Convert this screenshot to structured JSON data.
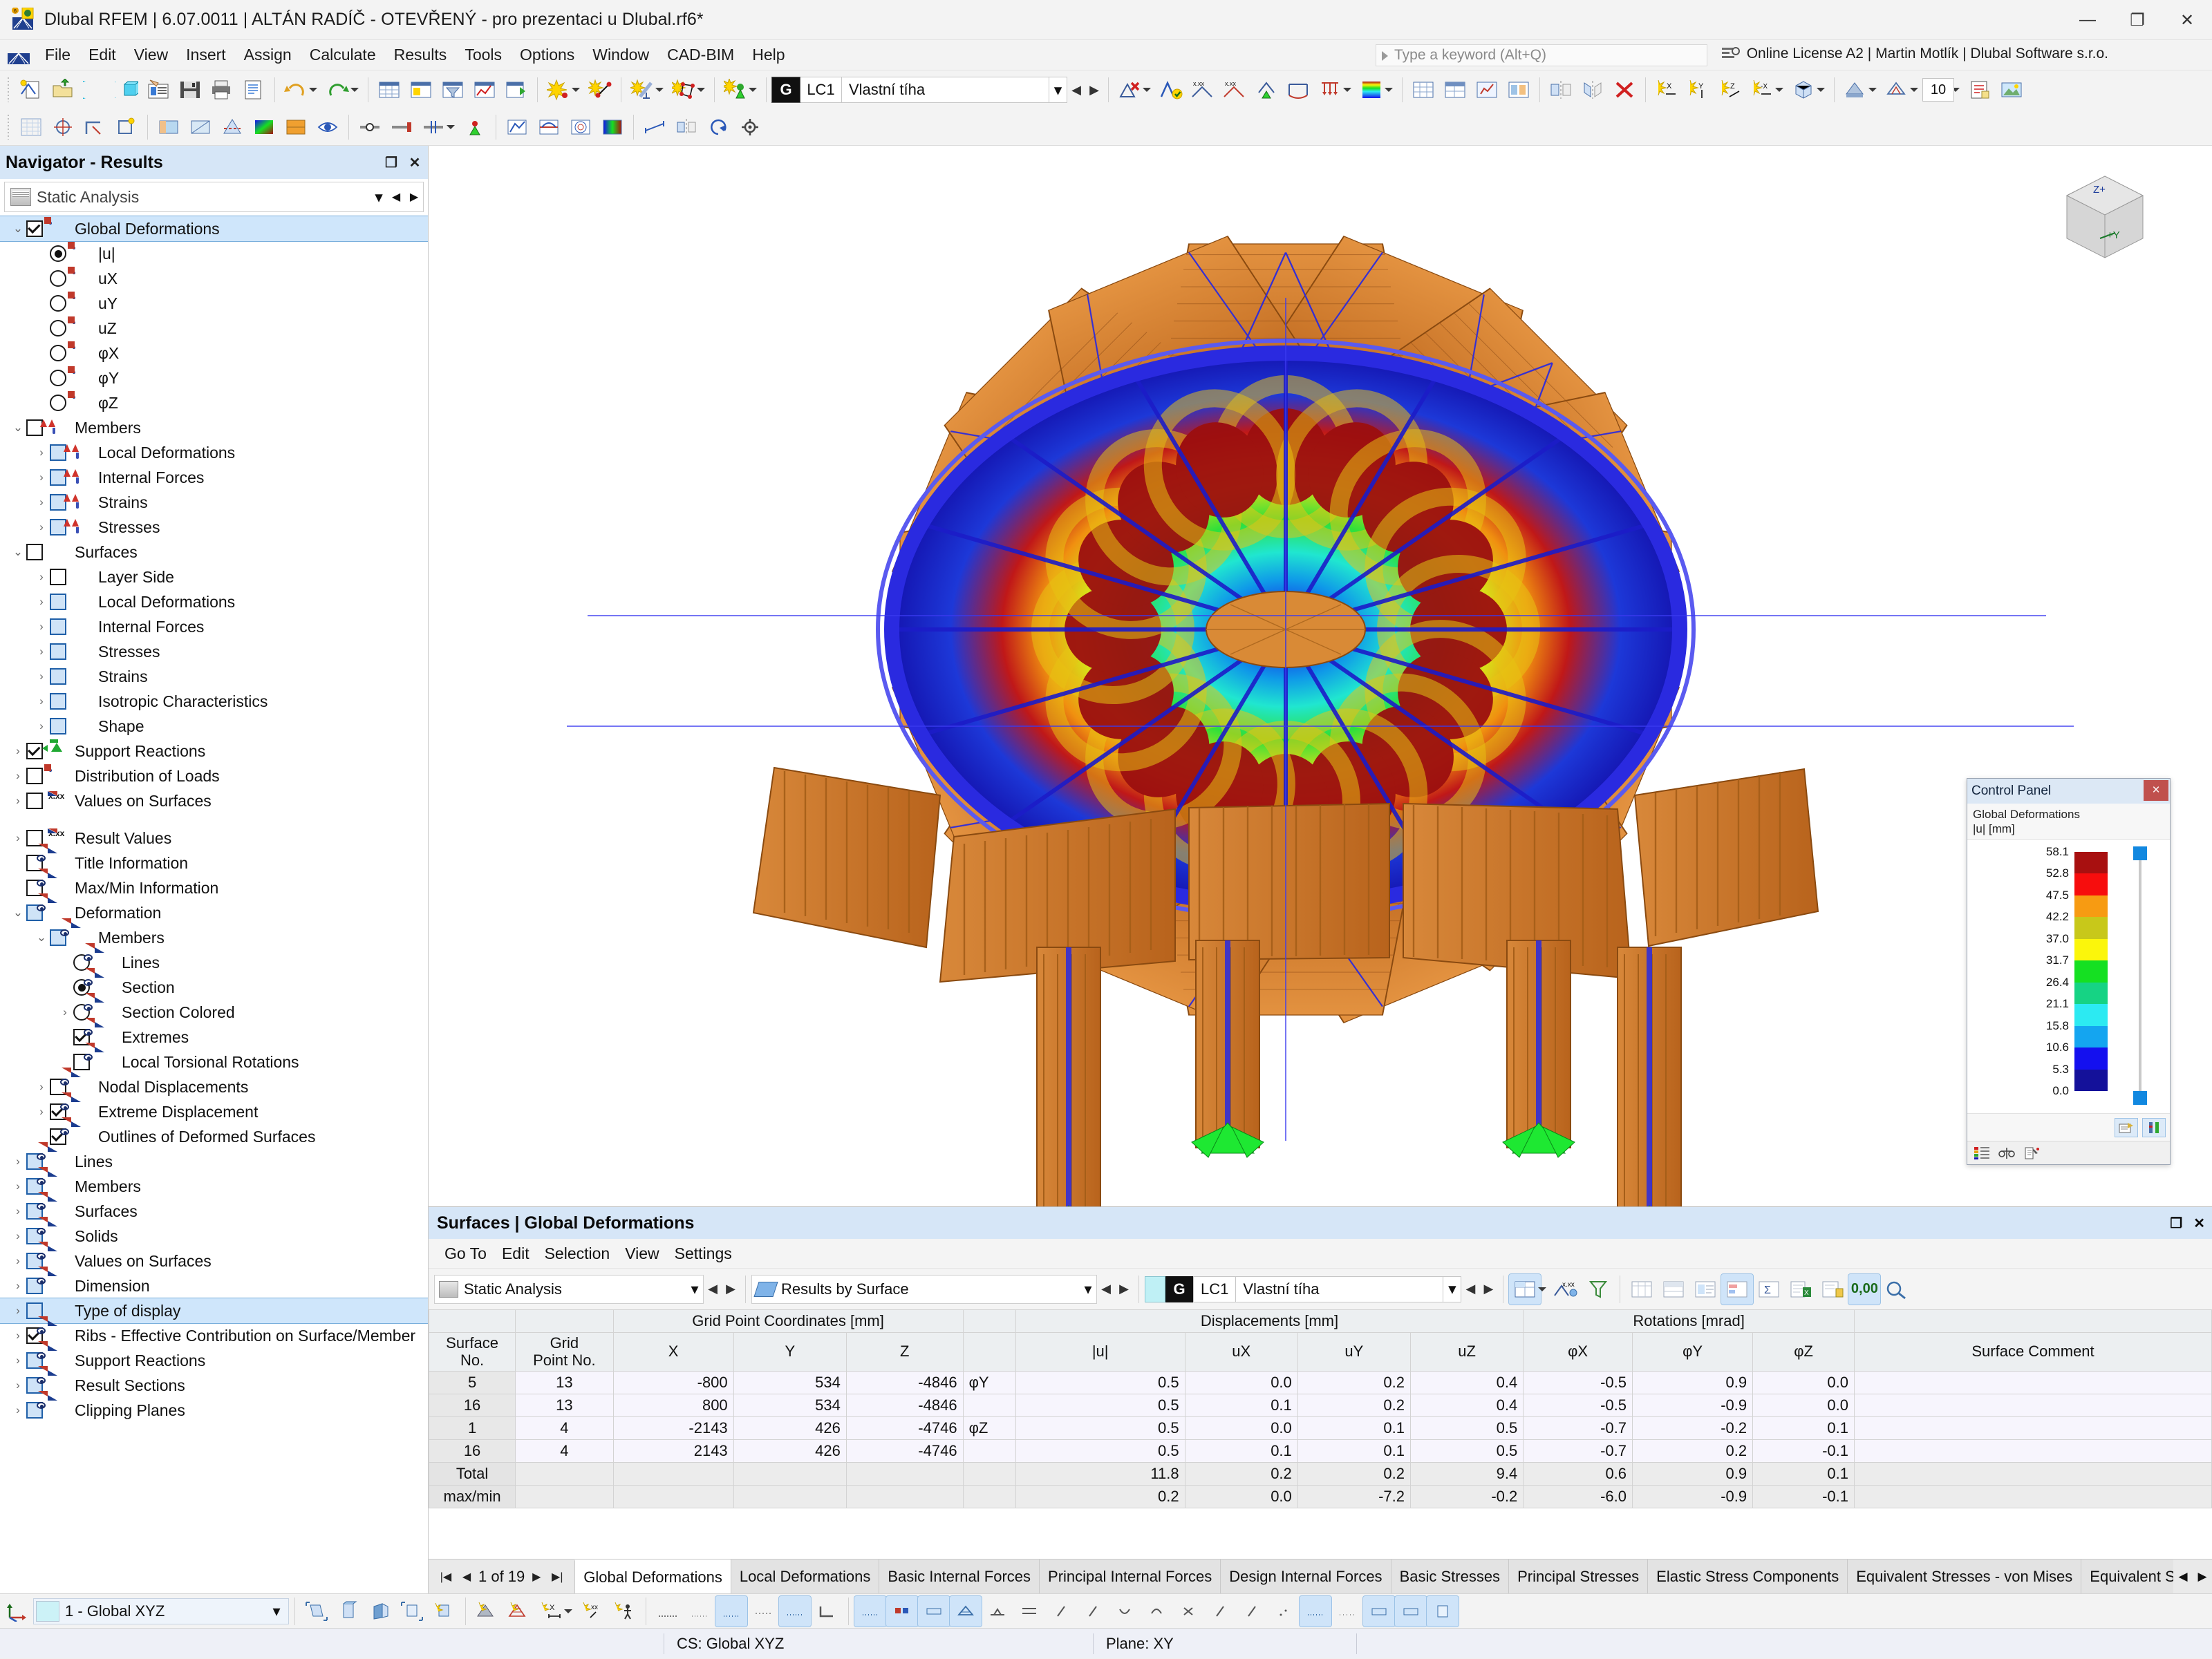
{
  "window": {
    "title": "Dlubal RFEM | 6.07.0011 | ALTÁN RADÍČ - OTEVŘENÝ - pro prezentaci u Dlubal.rf6*",
    "minimize": "—",
    "maximize": "❐",
    "close": "✕"
  },
  "menubar": {
    "items": [
      "File",
      "Edit",
      "View",
      "Insert",
      "Assign",
      "Calculate",
      "Results",
      "Tools",
      "Options",
      "Window",
      "CAD-BIM",
      "Help"
    ],
    "quick_search_placeholder": "Type a keyword (Alt+Q)",
    "license": "Online License A2 | Martin Motlík | Dlubal Software s.r.o."
  },
  "toolbar": {
    "load_case_tag": "G",
    "load_case_no": "LC1",
    "load_case_name": "Vlastní tíha",
    "zoom_value": "10"
  },
  "navigator": {
    "title": "Navigator - Results",
    "analysis_combo": "Static Analysis",
    "tree": [
      {
        "label": "Global Deformations",
        "indent": 0,
        "expander": "v",
        "ctrl": "check-on",
        "icon": "deformation",
        "selected": true
      },
      {
        "label": "|u|",
        "indent": 1,
        "expander": "",
        "ctrl": "radio-on",
        "icon": "deformation"
      },
      {
        "label": "uX",
        "indent": 1,
        "expander": "",
        "ctrl": "radio",
        "icon": "deformation"
      },
      {
        "label": "uY",
        "indent": 1,
        "expander": "",
        "ctrl": "radio",
        "icon": "deformation"
      },
      {
        "label": "uZ",
        "indent": 1,
        "expander": "",
        "ctrl": "radio",
        "icon": "deformation"
      },
      {
        "label": "φX",
        "indent": 1,
        "expander": "",
        "ctrl": "radio",
        "icon": "deformation"
      },
      {
        "label": "φY",
        "indent": 1,
        "expander": "",
        "ctrl": "radio",
        "icon": "deformation"
      },
      {
        "label": "φZ",
        "indent": 1,
        "expander": "",
        "ctrl": "radio",
        "icon": "deformation"
      },
      {
        "label": "Members",
        "indent": 0,
        "expander": "v",
        "ctrl": "check",
        "icon": "member"
      },
      {
        "label": "Local Deformations",
        "indent": 1,
        "expander": ">",
        "ctrl": "check-blue",
        "icon": "member"
      },
      {
        "label": "Internal Forces",
        "indent": 1,
        "expander": ">",
        "ctrl": "check-blue",
        "icon": "member"
      },
      {
        "label": "Strains",
        "indent": 1,
        "expander": ">",
        "ctrl": "check-blue",
        "icon": "member"
      },
      {
        "label": "Stresses",
        "indent": 1,
        "expander": ">",
        "ctrl": "check-blue",
        "icon": "member"
      },
      {
        "label": "Surfaces",
        "indent": 0,
        "expander": "v",
        "ctrl": "check",
        "icon": "surface"
      },
      {
        "label": "Layer Side",
        "indent": 1,
        "expander": ">",
        "ctrl": "check",
        "icon": "surface"
      },
      {
        "label": "Local Deformations",
        "indent": 1,
        "expander": ">",
        "ctrl": "check-blue",
        "icon": "surface"
      },
      {
        "label": "Internal Forces",
        "indent": 1,
        "expander": ">",
        "ctrl": "check-blue",
        "icon": "surface"
      },
      {
        "label": "Stresses",
        "indent": 1,
        "expander": ">",
        "ctrl": "check-blue",
        "icon": "surface"
      },
      {
        "label": "Strains",
        "indent": 1,
        "expander": ">",
        "ctrl": "check-blue",
        "icon": "surface"
      },
      {
        "label": "Isotropic Characteristics",
        "indent": 1,
        "expander": ">",
        "ctrl": "check-blue",
        "icon": "surface"
      },
      {
        "label": "Shape",
        "indent": 1,
        "expander": ">",
        "ctrl": "check-blue",
        "icon": "surface"
      },
      {
        "label": "Support Reactions",
        "indent": 0,
        "expander": ">",
        "ctrl": "check-on",
        "icon": "support"
      },
      {
        "label": "Distribution of Loads",
        "indent": 0,
        "expander": ">",
        "ctrl": "check",
        "icon": "deformation"
      },
      {
        "label": "Values on Surfaces",
        "indent": 0,
        "expander": ">",
        "ctrl": "check",
        "icon": "xxx"
      },
      {
        "label": "",
        "indent": 0,
        "expander": "",
        "ctrl": "gap",
        "icon": "none"
      },
      {
        "label": "Result Values",
        "indent": 0,
        "expander": ">",
        "ctrl": "check",
        "icon": "xxx"
      },
      {
        "label": "Title Information",
        "indent": 0,
        "expander": "",
        "ctrl": "check",
        "icon": "eye"
      },
      {
        "label": "Max/Min Information",
        "indent": 0,
        "expander": "",
        "ctrl": "check",
        "icon": "eye"
      },
      {
        "label": "Deformation",
        "indent": 0,
        "expander": "v",
        "ctrl": "check-blue",
        "icon": "eye"
      },
      {
        "label": "Members",
        "indent": 1,
        "expander": "v",
        "ctrl": "check-blue",
        "icon": "eye"
      },
      {
        "label": "Lines",
        "indent": 2,
        "expander": "",
        "ctrl": "radio",
        "icon": "eye"
      },
      {
        "label": "Section",
        "indent": 2,
        "expander": "",
        "ctrl": "radio-on",
        "icon": "eye"
      },
      {
        "label": "Section Colored",
        "indent": 2,
        "expander": ">",
        "ctrl": "radio",
        "icon": "eye"
      },
      {
        "label": "Extremes",
        "indent": 2,
        "expander": "",
        "ctrl": "check-on",
        "icon": "eye"
      },
      {
        "label": "Local Torsional Rotations",
        "indent": 2,
        "expander": "",
        "ctrl": "check",
        "icon": "eye"
      },
      {
        "label": "Nodal Displacements",
        "indent": 1,
        "expander": ">",
        "ctrl": "check",
        "icon": "eye"
      },
      {
        "label": "Extreme Displacement",
        "indent": 1,
        "expander": ">",
        "ctrl": "check-on",
        "icon": "eye"
      },
      {
        "label": "Outlines of Deformed Surfaces",
        "indent": 1,
        "expander": "",
        "ctrl": "check-on",
        "icon": "eye"
      },
      {
        "label": "Lines",
        "indent": 0,
        "expander": ">",
        "ctrl": "check-blue",
        "icon": "eye"
      },
      {
        "label": "Members",
        "indent": 0,
        "expander": ">",
        "ctrl": "check-blue",
        "icon": "eye"
      },
      {
        "label": "Surfaces",
        "indent": 0,
        "expander": ">",
        "ctrl": "check-blue",
        "icon": "eye"
      },
      {
        "label": "Solids",
        "indent": 0,
        "expander": ">",
        "ctrl": "check-blue",
        "icon": "eye"
      },
      {
        "label": "Values on Surfaces",
        "indent": 0,
        "expander": ">",
        "ctrl": "check-blue",
        "icon": "eye"
      },
      {
        "label": "Dimension",
        "indent": 0,
        "expander": ">",
        "ctrl": "check-blue",
        "icon": "eye"
      },
      {
        "label": "Type of display",
        "indent": 0,
        "expander": ">",
        "ctrl": "check-blue",
        "icon": "display",
        "selected": true
      },
      {
        "label": "Ribs - Effective Contribution on Surface/Member",
        "indent": 0,
        "expander": ">",
        "ctrl": "check-on",
        "icon": "eye"
      },
      {
        "label": "Support Reactions",
        "indent": 0,
        "expander": ">",
        "ctrl": "check-blue",
        "icon": "eye"
      },
      {
        "label": "Result Sections",
        "indent": 0,
        "expander": ">",
        "ctrl": "check-blue",
        "icon": "eye"
      },
      {
        "label": "Clipping Planes",
        "indent": 0,
        "expander": ">",
        "ctrl": "check-blue",
        "icon": "eye"
      }
    ]
  },
  "axis_cube": {
    "z_label": "Z+",
    "y_label": "+Y"
  },
  "control_panel": {
    "title": "Control Panel",
    "close": "×",
    "subtitle_line1": "Global Deformations",
    "subtitle_line2": "|u| [mm]",
    "legend_values": [
      "58.1",
      "52.8",
      "47.5",
      "42.2",
      "37.0",
      "31.7",
      "26.4",
      "21.1",
      "15.8",
      "10.6",
      "5.3",
      "0.0"
    ],
    "legend_colors": [
      "#a81010",
      "#f70d0d",
      "#f79b12",
      "#c8c81a",
      "#fbf60b",
      "#15e022",
      "#16d384",
      "#2ceaf2",
      "#14a5f0",
      "#1410ef",
      "#14119a"
    ]
  },
  "chart_data": {
    "type": "heatmap",
    "title": "Global Deformations |u| [mm]",
    "quantity": "|u|",
    "unit": "mm",
    "scale_labels": [
      "58.1",
      "52.8",
      "47.5",
      "42.2",
      "37.0",
      "31.7",
      "26.4",
      "21.1",
      "15.8",
      "10.6",
      "5.3",
      "0.0"
    ],
    "scale_min": 0.0,
    "scale_max": 58.1,
    "band_colors": [
      "#a81010",
      "#f70d0d",
      "#f79b12",
      "#c8c81a",
      "#fbf60b",
      "#15e022",
      "#16d384",
      "#2ceaf2",
      "#14a5f0",
      "#1410ef",
      "#14119a"
    ],
    "legend_position": "right"
  },
  "results_panel": {
    "title": "Surfaces | Global Deformations",
    "menu": [
      "Go To",
      "Edit",
      "Selection",
      "View",
      "Settings"
    ],
    "analysis_combo": "Static Analysis",
    "results_combo": "Results by Surface",
    "lc_tag": "G",
    "lc_no": "LC1",
    "lc_name": "Vlastní tíha",
    "zero_button": "0,00",
    "table": {
      "group_headers": [
        {
          "label": "",
          "span": 1
        },
        {
          "label": "",
          "span": 1
        },
        {
          "label": "Grid Point Coordinates [mm]",
          "span": 3
        },
        {
          "label": "",
          "span": 1
        },
        {
          "label": "Displacements [mm]",
          "span": 4
        },
        {
          "label": "Rotations [mrad]",
          "span": 3
        },
        {
          "label": "",
          "span": 1
        }
      ],
      "headers": [
        {
          "l1": "Surface",
          "l2": "No."
        },
        {
          "l1": "Grid",
          "l2": "Point No."
        },
        {
          "l1": "",
          "l2": "X"
        },
        {
          "l1": "",
          "l2": "Y"
        },
        {
          "l1": "",
          "l2": "Z"
        },
        {
          "l1": "",
          "l2": ""
        },
        {
          "l1": "",
          "l2": "|u|"
        },
        {
          "l1": "",
          "l2": "uX"
        },
        {
          "l1": "",
          "l2": "uY"
        },
        {
          "l1": "",
          "l2": "uZ"
        },
        {
          "l1": "",
          "l2": "φX"
        },
        {
          "l1": "",
          "l2": "φY"
        },
        {
          "l1": "",
          "l2": "φZ"
        },
        {
          "l1": "",
          "l2": "Surface Comment"
        }
      ],
      "rows": [
        {
          "surface": "5",
          "grid": "13",
          "x": "-800",
          "y": "534",
          "z": "-4846",
          "note": "φY",
          "u": "0.5",
          "ux": "0.0",
          "uy": "0.2",
          "uz": "0.4",
          "phix": "-0.5",
          "phiy": "0.9",
          "phiz": "0.0",
          "comment": ""
        },
        {
          "surface": "16",
          "grid": "13",
          "x": "800",
          "y": "534",
          "z": "-4846",
          "note": "",
          "u": "0.5",
          "ux": "0.1",
          "uy": "0.2",
          "uz": "0.4",
          "phix": "-0.5",
          "phiy": "-0.9",
          "phiz": "0.0",
          "comment": ""
        },
        {
          "surface": "1",
          "grid": "4",
          "x": "-2143",
          "y": "426",
          "z": "-4746",
          "note": "φZ",
          "u": "0.5",
          "ux": "0.0",
          "uy": "0.1",
          "uz": "0.5",
          "phix": "-0.7",
          "phiy": "-0.2",
          "phiz": "0.1",
          "comment": ""
        },
        {
          "surface": "16",
          "grid": "4",
          "x": "2143",
          "y": "426",
          "z": "-4746",
          "note": "",
          "u": "0.5",
          "ux": "0.1",
          "uy": "0.1",
          "uz": "0.5",
          "phix": "-0.7",
          "phiy": "0.2",
          "phiz": "-0.1",
          "comment": ""
        }
      ],
      "footer": [
        {
          "label": "Total",
          "u": "11.8",
          "ux": "0.2",
          "uy": "0.2",
          "uz": "9.4",
          "phix": "0.6",
          "phiy": "0.9",
          "phiz": "0.1"
        },
        {
          "label": "max/min",
          "u": "0.2",
          "ux": "0.0",
          "uy": "-7.2",
          "uz": "-0.2",
          "phix": "-6.0",
          "phiy": "-0.9",
          "phiz": "-0.1"
        }
      ]
    },
    "pager": {
      "first": "|◀",
      "prev": "◀",
      "text": "1 of 19",
      "next": "▶",
      "last": "▶|"
    },
    "tabs": [
      "Global Deformations",
      "Local Deformations",
      "Basic Internal Forces",
      "Principal Internal Forces",
      "Design Internal Forces",
      "Basic Stresses",
      "Principal Stresses",
      "Elastic Stress Components",
      "Equivalent Stresses - von Mises",
      "Equivalent Stresses - Tresca",
      "Equiv"
    ],
    "active_tab": "Global Deformations"
  },
  "statusbar": {
    "cs_combo": "1 - Global XYZ",
    "cs_text": "CS: Global XYZ",
    "plane_text": "Plane: XY"
  }
}
